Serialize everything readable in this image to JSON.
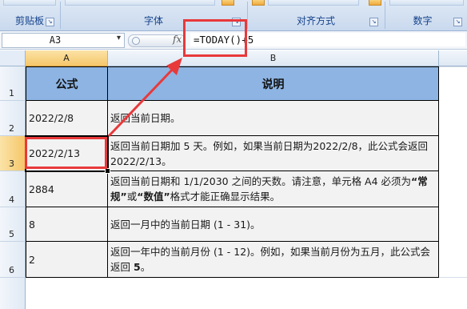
{
  "ribbon": {
    "groups": [
      {
        "label": "剪贴板"
      },
      {
        "label": "字体"
      },
      {
        "label": "对齐方式"
      },
      {
        "label": "数字"
      }
    ]
  },
  "formula_bar": {
    "name_box": "A3",
    "fx_label": "fx",
    "formula": "=TODAY()+5"
  },
  "columns": [
    "A",
    "B"
  ],
  "rows": [
    "1",
    "2",
    "3",
    "4",
    "5",
    "6"
  ],
  "table": {
    "headers": [
      "公式",
      "说明"
    ],
    "rows": [
      {
        "formula": "2022/2/8",
        "desc": "返回当前日期。"
      },
      {
        "formula": "2022/2/13",
        "desc": "返回当前日期加 5 天。例如，如果当前日期为2022/2/8，此公式会返回2022/2/13。"
      },
      {
        "formula": "2884",
        "desc_parts": [
          "返回当前日期和 1/1/2030 之间的天数。请注意，单元格 A4 必须为",
          "“常规”",
          "或",
          "“数值”",
          "格式才能正确显示结果。"
        ]
      },
      {
        "formula": "8",
        "desc": "返回一月中的当前日期 (1 - 31)。"
      },
      {
        "formula": "2",
        "desc_parts": [
          "返回一年中的当前月份 (1 - 12)。例如，如果当前月份为五月，此公式会返回 ",
          "5",
          "。"
        ]
      }
    ]
  },
  "annotation_color": "#e8393b"
}
